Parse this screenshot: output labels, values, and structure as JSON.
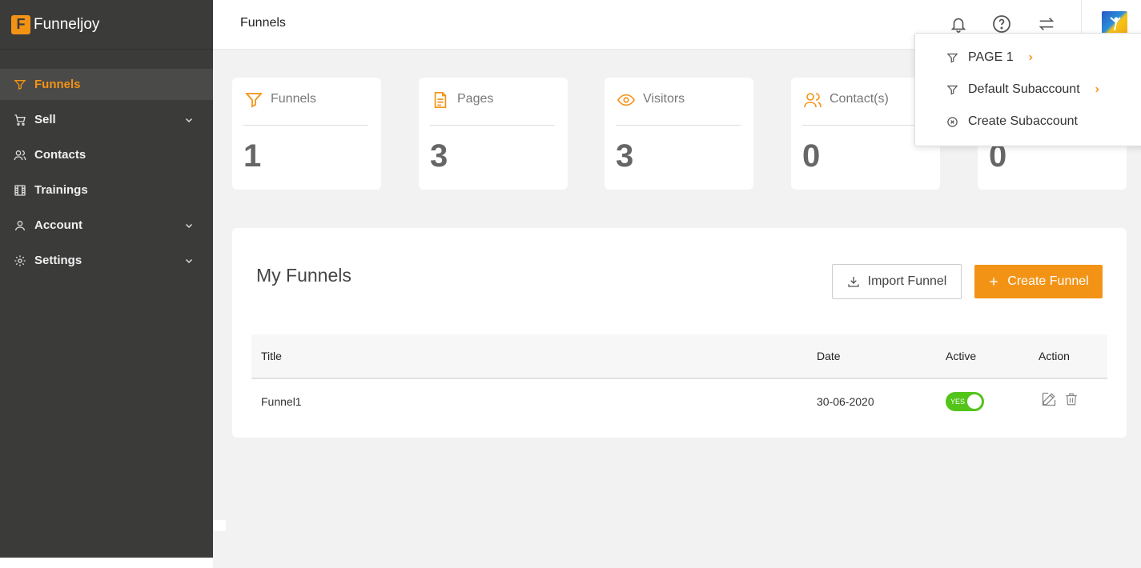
{
  "app": {
    "logo_letter": "F",
    "name": "Funneljoy"
  },
  "colors": {
    "accent": "#f39316",
    "sidebar": "#3b3b3a",
    "toggle_on": "#52c41a"
  },
  "sidebar": {
    "items": [
      {
        "label": "Funnels",
        "icon": "funnel-icon",
        "active": true,
        "expandable": false
      },
      {
        "label": "Sell",
        "icon": "cart-icon",
        "active": false,
        "expandable": true
      },
      {
        "label": "Contacts",
        "icon": "users-icon",
        "active": false,
        "expandable": false
      },
      {
        "label": "Trainings",
        "icon": "film-icon",
        "active": false,
        "expandable": false
      },
      {
        "label": "Account",
        "icon": "user-icon",
        "active": false,
        "expandable": true
      },
      {
        "label": "Settings",
        "icon": "gear-icon",
        "active": false,
        "expandable": true
      }
    ]
  },
  "header": {
    "title": "Funnels",
    "icons": [
      "bell-icon",
      "help-icon",
      "switch-icon",
      "avatar"
    ]
  },
  "stats": [
    {
      "label": "Funnels",
      "value": "1",
      "icon": "funnel-icon"
    },
    {
      "label": "Pages",
      "value": "3",
      "icon": "page-icon"
    },
    {
      "label": "Visitors",
      "value": "3",
      "icon": "eye-icon"
    },
    {
      "label": "Contact(s)",
      "value": "0",
      "icon": "users-icon"
    },
    {
      "label": "",
      "value": "0",
      "icon": ""
    }
  ],
  "main": {
    "title": "My Funnels",
    "import_label": "Import Funnel",
    "create_label": "Create Funnel",
    "table": {
      "columns": [
        "Title",
        "Date",
        "Active",
        "Action"
      ],
      "rows": [
        {
          "title": "Funnel1",
          "date": "30-06-2020",
          "active_label": "YES",
          "active": true
        }
      ]
    }
  },
  "dropdown": {
    "items": [
      {
        "label": "PAGE 1",
        "icon": "funnel-icon",
        "has_submenu": true
      },
      {
        "label": "Default Subaccount",
        "icon": "funnel-icon",
        "has_submenu": true
      },
      {
        "label": "Create Subaccount",
        "icon": "close-circle-icon",
        "has_submenu": false
      }
    ]
  }
}
